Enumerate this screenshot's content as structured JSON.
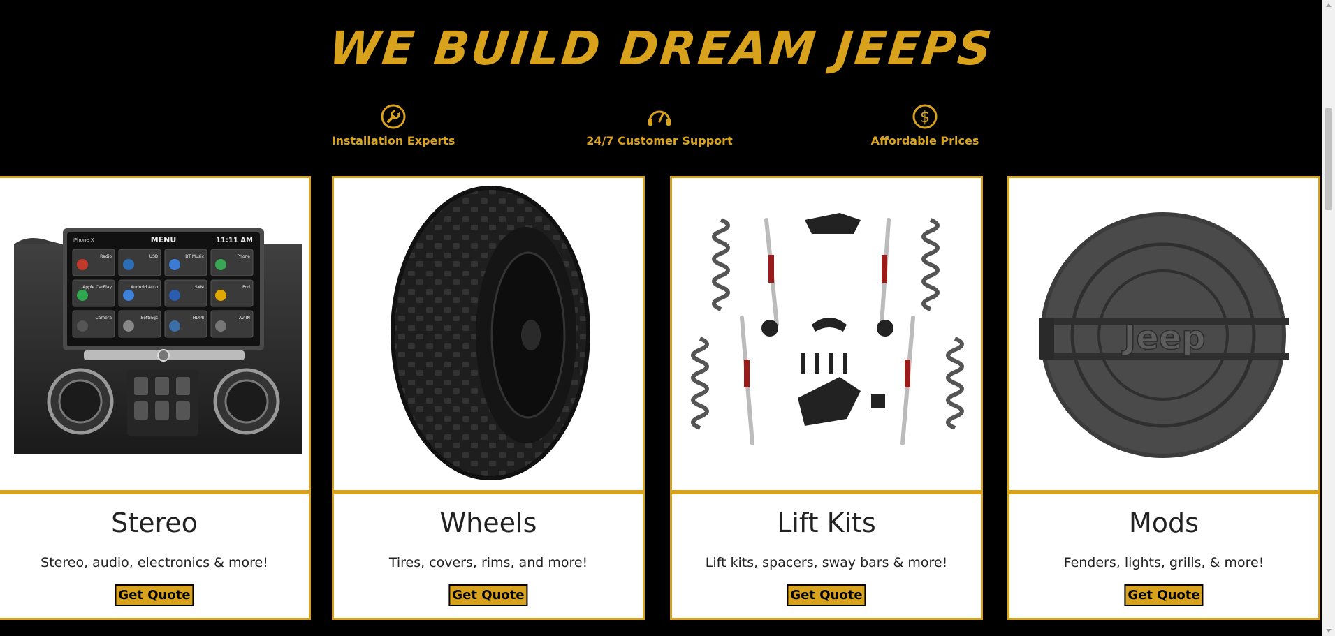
{
  "headline": "WE BUILD DREAM JEEPS",
  "colors": {
    "accent": "#d9a21c",
    "background": "#000000",
    "card": "#ffffff",
    "text": "#222222"
  },
  "features": [
    {
      "label": "Installation Experts",
      "icon": "wrench-icon"
    },
    {
      "label": "24/7 Customer Support",
      "icon": "headset-icon"
    },
    {
      "label": "Affordable Prices",
      "icon": "dollar-icon"
    }
  ],
  "cards": [
    {
      "title": "Stereo",
      "description": "Stereo, audio, electronics & more!",
      "button": "Get Quote",
      "image": "stereo-dashboard-image"
    },
    {
      "title": "Wheels",
      "description": "Tires, covers, rims, and more!",
      "button": "Get Quote",
      "image": "tire-wheel-image"
    },
    {
      "title": "Lift Kits",
      "description": "Lift kits, spacers, sway bars & more!",
      "button": "Get Quote",
      "image": "lift-kit-parts-image"
    },
    {
      "title": "Mods",
      "description": "Fenders, lights, grills, & more!",
      "button": "Get Quote",
      "image": "fuel-door-image"
    }
  ],
  "stereo_screen": {
    "carrier": "iPhone X",
    "menu": "MENU",
    "time": "11:11 AM",
    "tiles": [
      "Radio",
      "USB",
      "BT Music",
      "Phone",
      "Apple CarPlay",
      "Android Auto",
      "SXM",
      "iPod",
      "Camera",
      "Settings",
      "HDMI",
      "AV IN"
    ]
  },
  "mods_logo": "Jeep"
}
